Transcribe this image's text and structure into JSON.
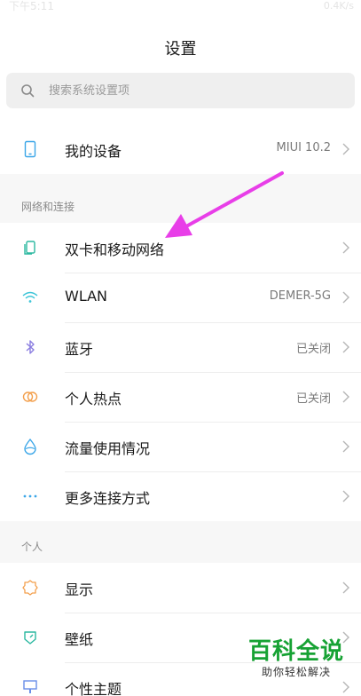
{
  "status_bar": {
    "time": "下午5:11",
    "right": "0.4K/s"
  },
  "header": {
    "title": "设置"
  },
  "search": {
    "placeholder": "搜索系统设置项"
  },
  "device_row": {
    "label": "我的设备",
    "value": "MIUI 10.2",
    "icon": "phone-icon"
  },
  "network_section": {
    "title": "网络和连接",
    "items": [
      {
        "label": "双卡和移动网络",
        "value": "",
        "icon": "sim-card-icon"
      },
      {
        "label": "WLAN",
        "value": "DEMER-5G",
        "icon": "wifi-icon"
      },
      {
        "label": "蓝牙",
        "value": "已关闭",
        "icon": "bluetooth-icon"
      },
      {
        "label": "个人热点",
        "value": "已关闭",
        "icon": "hotspot-icon"
      },
      {
        "label": "流量使用情况",
        "value": "",
        "icon": "data-drop-icon"
      },
      {
        "label": "更多连接方式",
        "value": "",
        "icon": "more-dots-icon"
      }
    ]
  },
  "personal_section": {
    "title": "个人",
    "items": [
      {
        "label": "显示",
        "value": "",
        "icon": "brightness-icon"
      },
      {
        "label": "壁纸",
        "value": "",
        "icon": "wallpaper-icon"
      },
      {
        "label": "个性主题",
        "value": "",
        "icon": "theme-icon"
      }
    ]
  },
  "watermark": {
    "main": "百科全说",
    "sub": "助你轻松解决"
  },
  "colors": {
    "arrow": "#e83ee8",
    "wifi": "#3ec5d8",
    "bluetooth": "#8a7de0",
    "hotspot": "#f3a04d",
    "data": "#3aa6e8",
    "display": "#f3a04d",
    "wallpaper": "#2bb8a0",
    "theme": "#6a8ee8",
    "device": "#3aa6e8",
    "watermark": "#17a234"
  }
}
